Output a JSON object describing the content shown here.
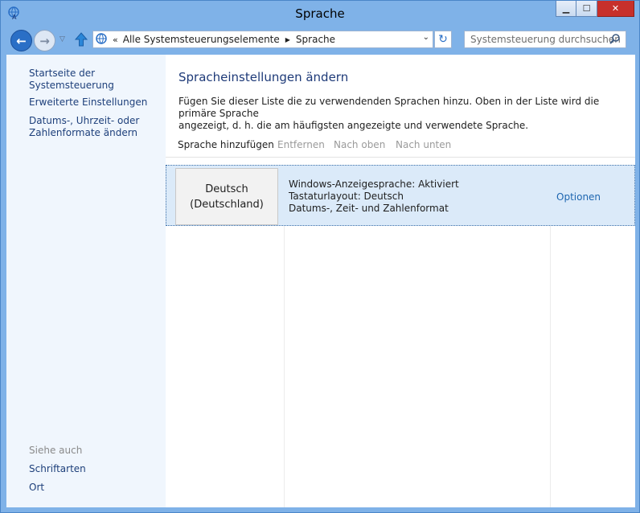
{
  "window": {
    "title": "Sprache"
  },
  "titlebar_buttons": {
    "minimize": "▁",
    "maximize": "☐",
    "close": "✕"
  },
  "navigation": {
    "back_icon": "←",
    "forward_icon": "→",
    "recent_icon": "▽",
    "breadcrumb_prefix": "«",
    "breadcrumbs": [
      "Alle Systemsteuerungselemente",
      "Sprache"
    ],
    "breadcrumb_separator": "▶",
    "dropdown_icon": "⌄",
    "refresh_icon": "↻",
    "search_placeholder": "Systemsteuerung durchsuchen"
  },
  "sidebar": {
    "home_link": "Startseite der Systemsteuerung",
    "links": [
      "Erweiterte Einstellungen",
      "Datums-, Uhrzeit- oder",
      "Zahlenformate ändern"
    ],
    "see_also_label": "Siehe auch",
    "see_also_links": [
      "Schriftarten",
      "Ort"
    ]
  },
  "main": {
    "heading": "Spracheinstellungen ändern",
    "description_lines": [
      "Fügen Sie dieser Liste die zu verwendenden Sprachen hinzu. Oben in der Liste wird die primäre Sprache",
      "angezeigt, d. h. die am häufigsten angezeigte und verwendete Sprache."
    ],
    "toolbar": {
      "add": "Sprache hinzufügen",
      "remove": "Entfernen",
      "move_up": "Nach oben",
      "move_down": "Nach unten"
    }
  },
  "languages": [
    {
      "name_line1": "Deutsch",
      "name_line2": "(Deutschland)",
      "details": [
        "Windows-Anzeigesprache: Aktiviert",
        "Tastaturlayout: Deutsch",
        "Datums-, Zeit- und Zahlenformat"
      ],
      "options_label": "Optionen"
    }
  ],
  "colors": {
    "accent": "#2a6fc6",
    "link": "#1d3f7a",
    "heading": "#1e3a78",
    "selection": "#dbeaf9",
    "close": "#c7302b"
  }
}
